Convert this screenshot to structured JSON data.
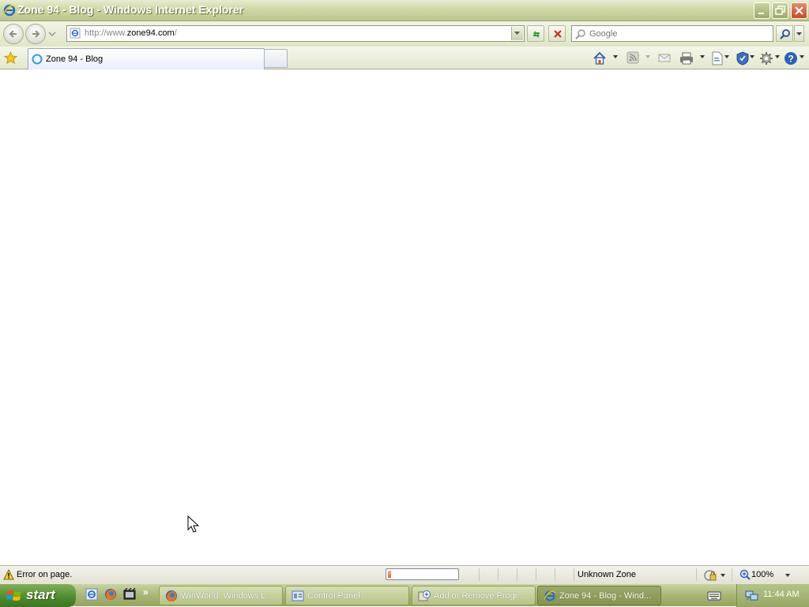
{
  "window": {
    "title": "Zone 94 - Blog - Windows Internet Explorer"
  },
  "navbar": {
    "url_prefix": "http://www.",
    "url_domain": "zone94.com",
    "url_suffix": "/",
    "search_placeholder": "Google"
  },
  "tabs": [
    {
      "label": "Zone 94 - Blog"
    }
  ],
  "statusbar": {
    "message": "Error on page.",
    "progress": 0.05,
    "zone": "Unknown Zone",
    "zoom": "100%"
  },
  "taskbar": {
    "start_label": "start",
    "tasks": [
      {
        "label": "WinWorld: Windows L...",
        "icon": "firefox-icon",
        "active": false
      },
      {
        "label": "Control Panel",
        "icon": "control-panel-icon",
        "active": false
      },
      {
        "label": "Add or Remove Progr...",
        "icon": "add-remove-programs-icon",
        "active": false
      },
      {
        "label": "Zone 94 - Blog - Wind...",
        "icon": "ie-icon",
        "active": true
      }
    ],
    "clock": "11:44 AM"
  },
  "colors": {
    "title_bar": "#cfd8a6",
    "taskbar": "#a9b676",
    "start_button": "#4e8a2c",
    "progress_fill": "#d86a30"
  }
}
